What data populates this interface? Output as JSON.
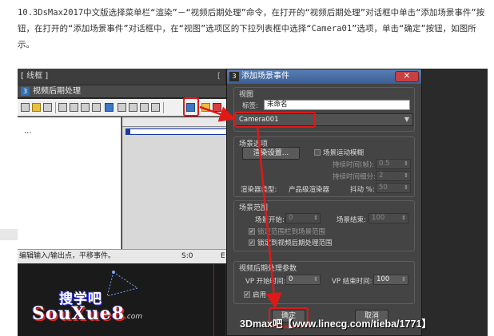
{
  "article": {
    "paragraph": "10.3DsMax2017中文版选择菜单栏“渲染”－“视频后期处理”命令，在打开的“视频后期处理”对话框中单击“添加场景事件”按钮，在打开的“添加场景事件”对话框中，在“视图”选项区的下拉列表框中选择“Camera01”选项，单击“确定”按钮，如图所示。"
  },
  "background_window": {
    "tab_label": "[ 线框 ]",
    "tab_right": "[",
    "title_number": "3",
    "title": "视频后期处理",
    "list_placeholder": "...",
    "status_text": "编辑输入/输出点，平移事件。",
    "status_value": "S:0",
    "status_right": "E"
  },
  "logo": {
    "top": "搜学吧",
    "bottom": "SouXue8",
    "suffix": ".com"
  },
  "dialog": {
    "icon": "3",
    "title": "添加场景事件",
    "close_label": "✕",
    "view_section": "视图",
    "label_field": "标签:",
    "label_value": "未命名",
    "camera_value": "Camera001",
    "scene_options_section": "场景选项",
    "render_settings_button": "渲染设置...",
    "scene_motion_blur": "场景运动模糊",
    "duration_frames_label": "持续时间(帧):",
    "duration_frames_value": "0.5",
    "duration_subdivs_label": "持续时间细分:",
    "duration_subdivs_value": "2",
    "renderer_type_label": "渲染器类型:",
    "renderer_type_value": "产品级渲染器",
    "dither_label": "抖动 %:",
    "dither_value": "50",
    "scene_range_section": "场景范围",
    "scene_start_label": "场景开始:",
    "scene_start_value": "0",
    "scene_end_label": "场景结束:",
    "scene_end_value": "100",
    "lock_range_label": "锁定范围栏到场景范围",
    "lock_to_vp_label": "锁定到视频后期处理范围",
    "vp_params_section": "视频后期处理参数",
    "vp_start_label": "VP 开始时间:",
    "vp_start_value": "0",
    "vp_end_label": "VP 结束时间:",
    "vp_end_value": "100",
    "enabled_label": "启用",
    "ok_button": "确定",
    "cancel_button": "取消"
  },
  "watermark": "3Dmax吧【www.linecg.com/tieba/1771】",
  "colors": {
    "annotation_red": "#e01818",
    "dialog_bg": "#444444",
    "title_blue": "#3a5f95"
  }
}
